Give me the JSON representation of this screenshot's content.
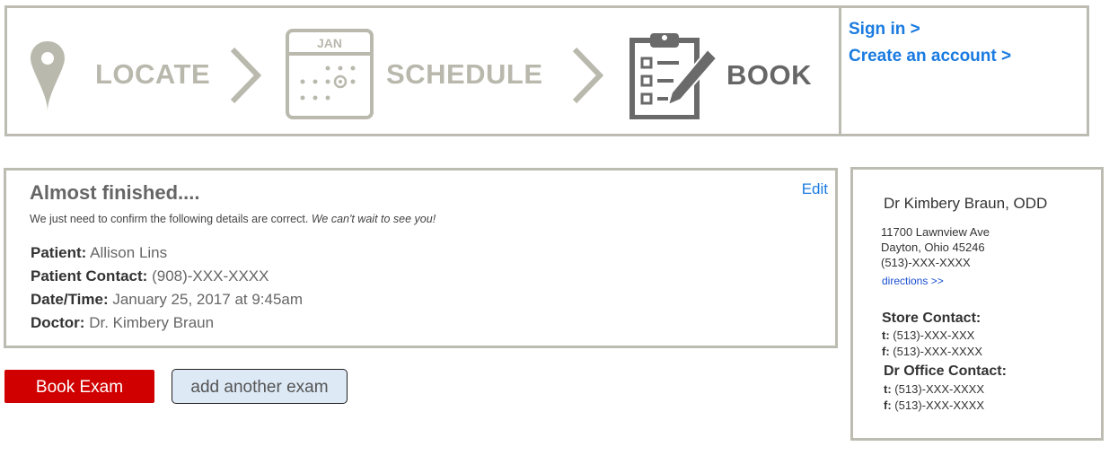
{
  "steps": [
    {
      "label": "LOCATE",
      "icon": "location-pin-icon",
      "active": false
    },
    {
      "label": "SCHEDULE",
      "icon": "calendar-icon",
      "active": false,
      "calendar_month": "JAN"
    },
    {
      "label": "BOOK",
      "icon": "clipboard-icon",
      "active": true
    }
  ],
  "account": {
    "sign_in": "Sign in >",
    "create_account": "Create an account >"
  },
  "summary": {
    "title": "Almost finished....",
    "edit": "Edit",
    "intro_text": "We just need to confirm the following details are correct.",
    "intro_emphasis": "We can't wait to see you!",
    "rows": [
      {
        "label": "Patient:",
        "value": "Allison Lins"
      },
      {
        "label": "Patient Contact:",
        "value": "(908)-XXX-XXXX"
      },
      {
        "label": "Date/Time:",
        "value": "January 25, 2017 at 9:45am"
      },
      {
        "label": "Doctor:",
        "value": "Dr. Kimbery Braun"
      }
    ]
  },
  "buttons": {
    "book": "Book Exam",
    "add": "add another exam"
  },
  "doctor": {
    "name": "Dr Kimbery Braun, ODD",
    "address_line1": "11700 Lawnview Ave",
    "address_line2": "Dayton, Ohio 45246",
    "phone": "(513)-XXX-XXXX",
    "directions": "directions >>",
    "store_title": "Store Contact:",
    "store_t_label": "t:",
    "store_t": "(513)-XXX-XXX",
    "store_f_label": "f:",
    "store_f": "(513)-XXX-XXXX",
    "office_title": "Dr Office Contact:",
    "office_t_label": "t:",
    "office_t": "(513)-XXX-XXXX",
    "office_f_label": "f:",
    "office_f": "(513)-XXX-XXXX"
  },
  "colors": {
    "accent_link": "#1a7be0",
    "book_button": "#d00000",
    "border_gray": "#bdbcb2",
    "inactive_step": "#b9b8ad",
    "active_step": "#666666"
  }
}
